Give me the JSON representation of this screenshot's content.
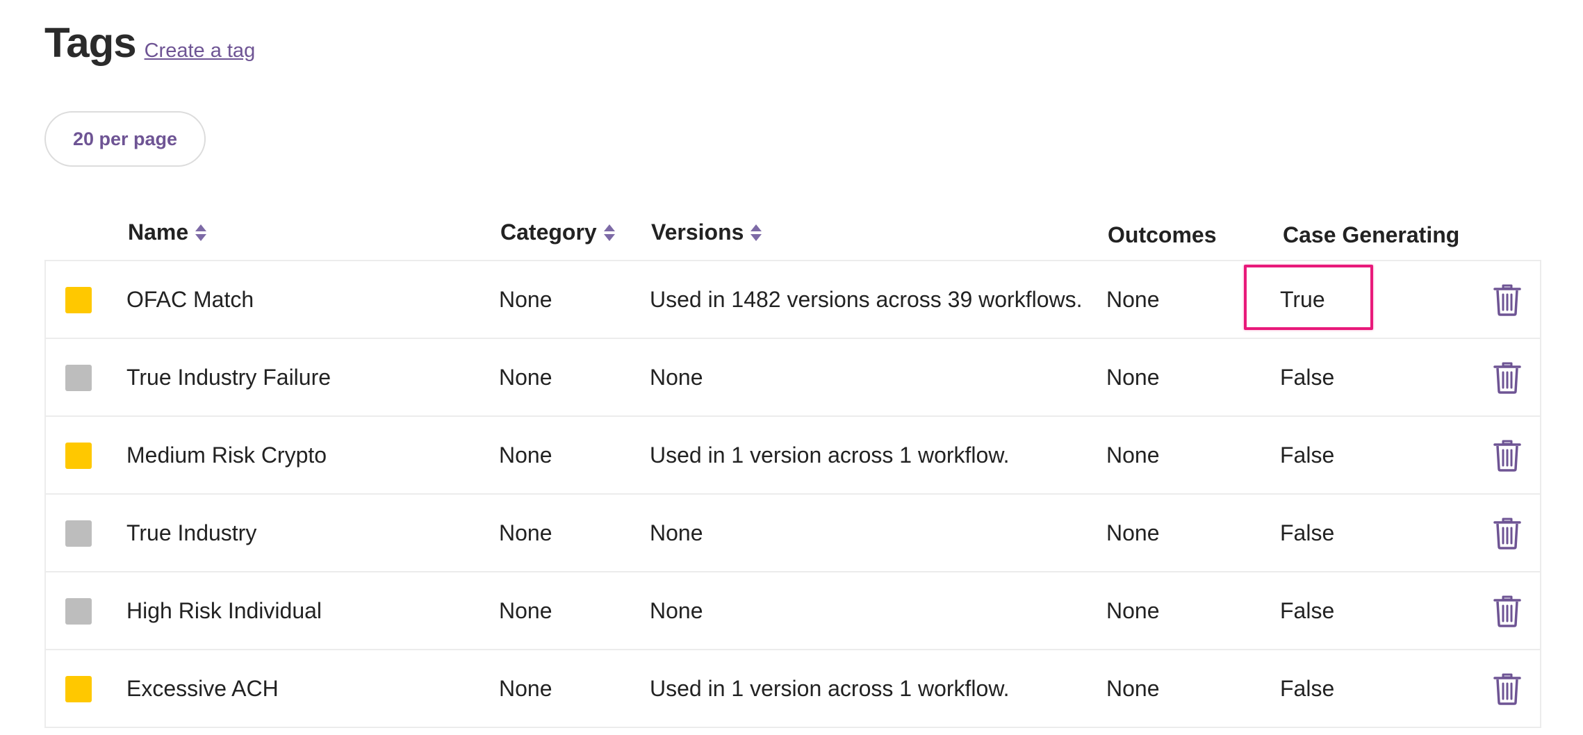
{
  "header": {
    "title": "Tags",
    "create_link": "Create a tag"
  },
  "pagination": {
    "per_page_label": "20 per page"
  },
  "table": {
    "columns": {
      "name": "Name",
      "category": "Category",
      "versions": "Versions",
      "outcomes": "Outcomes",
      "case_generating": "Case Generating"
    },
    "rows": [
      {
        "color": "#ffc800",
        "name": "OFAC Match",
        "category": "None",
        "versions": "Used in 1482 versions across 39 workflows.",
        "outcomes": "None",
        "case_generating": "True"
      },
      {
        "color": "#bdbdbd",
        "name": "True Industry Failure",
        "category": "None",
        "versions": "None",
        "outcomes": "None",
        "case_generating": "False"
      },
      {
        "color": "#ffc800",
        "name": "Medium Risk Crypto",
        "category": "None",
        "versions": "Used in 1 version across 1 workflow.",
        "outcomes": "None",
        "case_generating": "False"
      },
      {
        "color": "#bdbdbd",
        "name": "True Industry",
        "category": "None",
        "versions": "None",
        "outcomes": "None",
        "case_generating": "False"
      },
      {
        "color": "#bdbdbd",
        "name": "High Risk Individual",
        "category": "None",
        "versions": "None",
        "outcomes": "None",
        "case_generating": "False"
      },
      {
        "color": "#ffc800",
        "name": "Excessive ACH",
        "category": "None",
        "versions": "Used in 1 version across 1 workflow.",
        "outcomes": "None",
        "case_generating": "False"
      }
    ]
  },
  "colors": {
    "accent": "#6e5494",
    "highlight": "#e8197a"
  },
  "icons": {
    "sort": "sort-icon",
    "delete": "trash-icon"
  }
}
